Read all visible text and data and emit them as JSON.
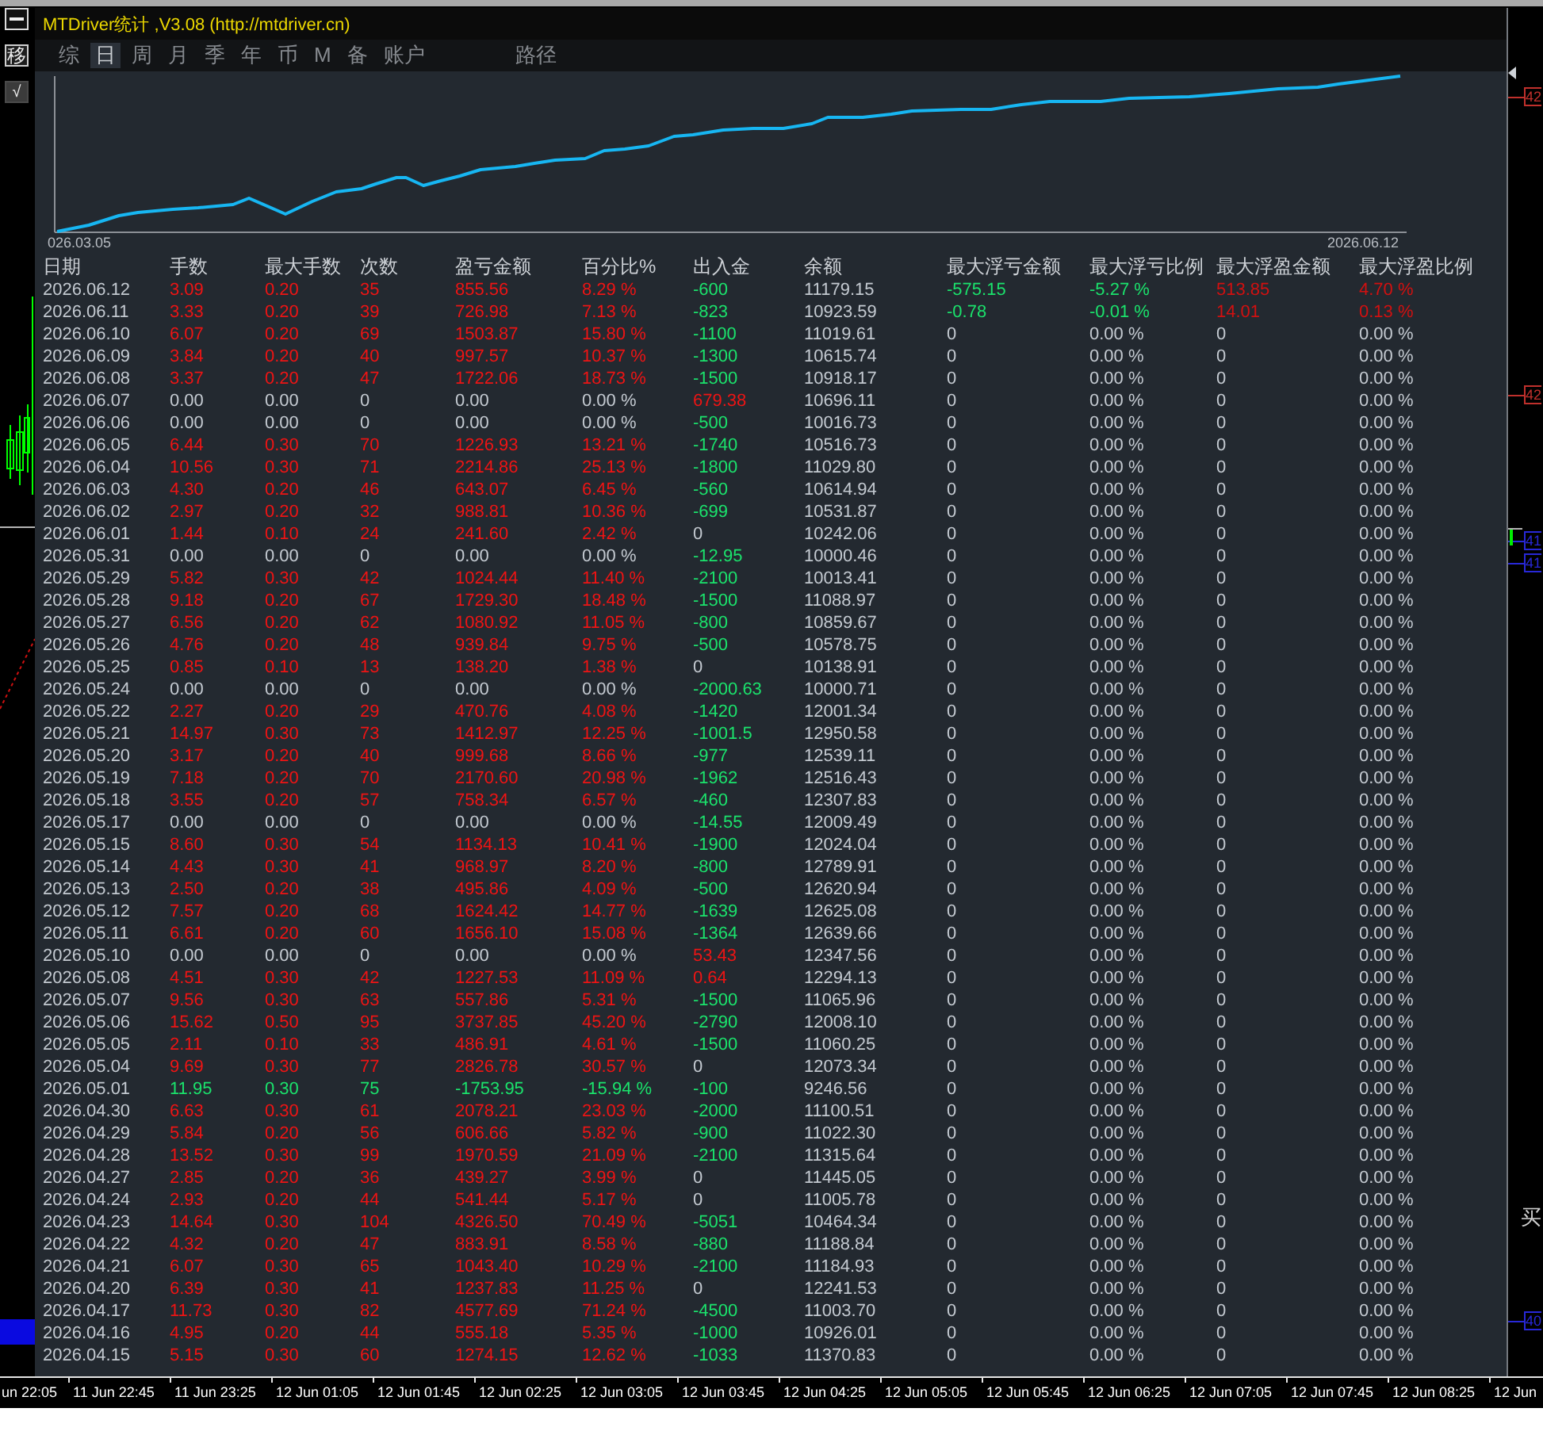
{
  "window": {
    "title": "MTDriver统计 ,V3.08 (http://mtdriver.cn)"
  },
  "side_buttons": [
    {
      "kind": "minimize"
    },
    {
      "kind": "char",
      "label": "移"
    },
    {
      "kind": "char",
      "label": "√"
    }
  ],
  "tabs": [
    {
      "label": "综",
      "selected": false
    },
    {
      "label": "日",
      "selected": true
    },
    {
      "label": "周",
      "selected": false
    },
    {
      "label": "月",
      "selected": false
    },
    {
      "label": "季",
      "selected": false
    },
    {
      "label": "年",
      "selected": false
    },
    {
      "label": "币",
      "selected": false
    },
    {
      "label": "M",
      "selected": false
    },
    {
      "label": "备",
      "selected": false
    },
    {
      "label": "账户",
      "selected": false
    }
  ],
  "path_tab": {
    "label": "路径",
    "selected": false
  },
  "equity_chart": {
    "start_label": "026.03.05",
    "end_label": "2026.06.12"
  },
  "table": {
    "columns": [
      "日期",
      "手数",
      "最大手数",
      "次数",
      "盈亏金额",
      "百分比%",
      "出入金",
      "余额",
      "最大浮亏金额",
      "最大浮亏比例",
      "最大浮盈金额",
      "最大浮盈比例"
    ],
    "rows": [
      {
        "profit": true,
        "loss": false,
        "deposit": false,
        "withdrawal": true,
        "floating": true,
        "cells": [
          "2026.06.12",
          "3.09",
          "0.20",
          "35",
          "855.56",
          "8.29 %",
          "-600",
          "11179.15",
          "-575.15",
          "-5.27 %",
          "513.85",
          "4.70 %"
        ]
      },
      {
        "profit": true,
        "loss": false,
        "deposit": false,
        "withdrawal": true,
        "floating": true,
        "cells": [
          "2026.06.11",
          "3.33",
          "0.20",
          "39",
          "726.98",
          "7.13 %",
          "-823",
          "10923.59",
          "-0.78",
          "-0.01 %",
          "14.01",
          "0.13 %"
        ]
      },
      {
        "profit": true,
        "loss": false,
        "deposit": false,
        "withdrawal": true,
        "floating": false,
        "cells": [
          "2026.06.10",
          "6.07",
          "0.20",
          "69",
          "1503.87",
          "15.80 %",
          "-1100",
          "11019.61",
          "0",
          "0.00 %",
          "0",
          "0.00 %"
        ]
      },
      {
        "profit": true,
        "loss": false,
        "deposit": false,
        "withdrawal": true,
        "floating": false,
        "cells": [
          "2026.06.09",
          "3.84",
          "0.20",
          "40",
          "997.57",
          "10.37 %",
          "-1300",
          "10615.74",
          "0",
          "0.00 %",
          "0",
          "0.00 %"
        ]
      },
      {
        "profit": true,
        "loss": false,
        "deposit": false,
        "withdrawal": true,
        "floating": false,
        "cells": [
          "2026.06.08",
          "3.37",
          "0.20",
          "47",
          "1722.06",
          "18.73 %",
          "-1500",
          "10918.17",
          "0",
          "0.00 %",
          "0",
          "0.00 %"
        ]
      },
      {
        "profit": false,
        "loss": false,
        "deposit": true,
        "withdrawal": false,
        "floating": false,
        "cells": [
          "2026.06.07",
          "0.00",
          "0.00",
          "0",
          "0.00",
          "0.00 %",
          "679.38",
          "10696.11",
          "0",
          "0.00 %",
          "0",
          "0.00 %"
        ]
      },
      {
        "profit": false,
        "loss": false,
        "deposit": false,
        "withdrawal": true,
        "floating": false,
        "cells": [
          "2026.06.06",
          "0.00",
          "0.00",
          "0",
          "0.00",
          "0.00 %",
          "-500",
          "10016.73",
          "0",
          "0.00 %",
          "0",
          "0.00 %"
        ]
      },
      {
        "profit": true,
        "loss": false,
        "deposit": false,
        "withdrawal": true,
        "floating": false,
        "cells": [
          "2026.06.05",
          "6.44",
          "0.30",
          "70",
          "1226.93",
          "13.21 %",
          "-1740",
          "10516.73",
          "0",
          "0.00 %",
          "0",
          "0.00 %"
        ]
      },
      {
        "profit": true,
        "loss": false,
        "deposit": false,
        "withdrawal": true,
        "floating": false,
        "cells": [
          "2026.06.04",
          "10.56",
          "0.30",
          "71",
          "2214.86",
          "25.13 %",
          "-1800",
          "11029.80",
          "0",
          "0.00 %",
          "0",
          "0.00 %"
        ]
      },
      {
        "profit": true,
        "loss": false,
        "deposit": false,
        "withdrawal": true,
        "floating": false,
        "cells": [
          "2026.06.03",
          "4.30",
          "0.20",
          "46",
          "643.07",
          "6.45 %",
          "-560",
          "10614.94",
          "0",
          "0.00 %",
          "0",
          "0.00 %"
        ]
      },
      {
        "profit": true,
        "loss": false,
        "deposit": false,
        "withdrawal": true,
        "floating": false,
        "cells": [
          "2026.06.02",
          "2.97",
          "0.20",
          "32",
          "988.81",
          "10.36 %",
          "-699",
          "10531.87",
          "0",
          "0.00 %",
          "0",
          "0.00 %"
        ]
      },
      {
        "profit": true,
        "loss": false,
        "deposit": false,
        "withdrawal": false,
        "floating": false,
        "cells": [
          "2026.06.01",
          "1.44",
          "0.10",
          "24",
          "241.60",
          "2.42 %",
          "0",
          "10242.06",
          "0",
          "0.00 %",
          "0",
          "0.00 %"
        ]
      },
      {
        "profit": false,
        "loss": false,
        "deposit": false,
        "withdrawal": true,
        "floating": false,
        "cells": [
          "2026.05.31",
          "0.00",
          "0.00",
          "0",
          "0.00",
          "0.00 %",
          "-12.95",
          "10000.46",
          "0",
          "0.00 %",
          "0",
          "0.00 %"
        ]
      },
      {
        "profit": true,
        "loss": false,
        "deposit": false,
        "withdrawal": true,
        "floating": false,
        "cells": [
          "2026.05.29",
          "5.82",
          "0.30",
          "42",
          "1024.44",
          "11.40 %",
          "-2100",
          "10013.41",
          "0",
          "0.00 %",
          "0",
          "0.00 %"
        ]
      },
      {
        "profit": true,
        "loss": false,
        "deposit": false,
        "withdrawal": true,
        "floating": false,
        "cells": [
          "2026.05.28",
          "9.18",
          "0.20",
          "67",
          "1729.30",
          "18.48 %",
          "-1500",
          "11088.97",
          "0",
          "0.00 %",
          "0",
          "0.00 %"
        ]
      },
      {
        "profit": true,
        "loss": false,
        "deposit": false,
        "withdrawal": true,
        "floating": false,
        "cells": [
          "2026.05.27",
          "6.56",
          "0.20",
          "62",
          "1080.92",
          "11.05 %",
          "-800",
          "10859.67",
          "0",
          "0.00 %",
          "0",
          "0.00 %"
        ]
      },
      {
        "profit": true,
        "loss": false,
        "deposit": false,
        "withdrawal": true,
        "floating": false,
        "cells": [
          "2026.05.26",
          "4.76",
          "0.20",
          "48",
          "939.84",
          "9.75 %",
          "-500",
          "10578.75",
          "0",
          "0.00 %",
          "0",
          "0.00 %"
        ]
      },
      {
        "profit": true,
        "loss": false,
        "deposit": false,
        "withdrawal": false,
        "floating": false,
        "cells": [
          "2026.05.25",
          "0.85",
          "0.10",
          "13",
          "138.20",
          "1.38 %",
          "0",
          "10138.91",
          "0",
          "0.00 %",
          "0",
          "0.00 %"
        ]
      },
      {
        "profit": false,
        "loss": false,
        "deposit": false,
        "withdrawal": true,
        "floating": false,
        "cells": [
          "2026.05.24",
          "0.00",
          "0.00",
          "0",
          "0.00",
          "0.00 %",
          "-2000.63",
          "10000.71",
          "0",
          "0.00 %",
          "0",
          "0.00 %"
        ]
      },
      {
        "profit": true,
        "loss": false,
        "deposit": false,
        "withdrawal": true,
        "floating": false,
        "cells": [
          "2026.05.22",
          "2.27",
          "0.20",
          "29",
          "470.76",
          "4.08 %",
          "-1420",
          "12001.34",
          "0",
          "0.00 %",
          "0",
          "0.00 %"
        ]
      },
      {
        "profit": true,
        "loss": false,
        "deposit": false,
        "withdrawal": true,
        "floating": false,
        "cells": [
          "2026.05.21",
          "14.97",
          "0.30",
          "73",
          "1412.97",
          "12.25 %",
          "-1001.5",
          "12950.58",
          "0",
          "0.00 %",
          "0",
          "0.00 %"
        ]
      },
      {
        "profit": true,
        "loss": false,
        "deposit": false,
        "withdrawal": true,
        "floating": false,
        "cells": [
          "2026.05.20",
          "3.17",
          "0.20",
          "40",
          "999.68",
          "8.66 %",
          "-977",
          "12539.11",
          "0",
          "0.00 %",
          "0",
          "0.00 %"
        ]
      },
      {
        "profit": true,
        "loss": false,
        "deposit": false,
        "withdrawal": true,
        "floating": false,
        "cells": [
          "2026.05.19",
          "7.18",
          "0.20",
          "70",
          "2170.60",
          "20.98 %",
          "-1962",
          "12516.43",
          "0",
          "0.00 %",
          "0",
          "0.00 %"
        ]
      },
      {
        "profit": true,
        "loss": false,
        "deposit": false,
        "withdrawal": true,
        "floating": false,
        "cells": [
          "2026.05.18",
          "3.55",
          "0.20",
          "57",
          "758.34",
          "6.57 %",
          "-460",
          "12307.83",
          "0",
          "0.00 %",
          "0",
          "0.00 %"
        ]
      },
      {
        "profit": false,
        "loss": false,
        "deposit": false,
        "withdrawal": true,
        "floating": false,
        "cells": [
          "2026.05.17",
          "0.00",
          "0.00",
          "0",
          "0.00",
          "0.00 %",
          "-14.55",
          "12009.49",
          "0",
          "0.00 %",
          "0",
          "0.00 %"
        ]
      },
      {
        "profit": true,
        "loss": false,
        "deposit": false,
        "withdrawal": true,
        "floating": false,
        "cells": [
          "2026.05.15",
          "8.60",
          "0.30",
          "54",
          "1134.13",
          "10.41 %",
          "-1900",
          "12024.04",
          "0",
          "0.00 %",
          "0",
          "0.00 %"
        ]
      },
      {
        "profit": true,
        "loss": false,
        "deposit": false,
        "withdrawal": true,
        "floating": false,
        "cells": [
          "2026.05.14",
          "4.43",
          "0.30",
          "41",
          "968.97",
          "8.20 %",
          "-800",
          "12789.91",
          "0",
          "0.00 %",
          "0",
          "0.00 %"
        ]
      },
      {
        "profit": true,
        "loss": false,
        "deposit": false,
        "withdrawal": true,
        "floating": false,
        "cells": [
          "2026.05.13",
          "2.50",
          "0.20",
          "38",
          "495.86",
          "4.09 %",
          "-500",
          "12620.94",
          "0",
          "0.00 %",
          "0",
          "0.00 %"
        ]
      },
      {
        "profit": true,
        "loss": false,
        "deposit": false,
        "withdrawal": true,
        "floating": false,
        "cells": [
          "2026.05.12",
          "7.57",
          "0.20",
          "68",
          "1624.42",
          "14.77 %",
          "-1639",
          "12625.08",
          "0",
          "0.00 %",
          "0",
          "0.00 %"
        ]
      },
      {
        "profit": true,
        "loss": false,
        "deposit": false,
        "withdrawal": true,
        "floating": false,
        "cells": [
          "2026.05.11",
          "6.61",
          "0.20",
          "60",
          "1656.10",
          "15.08 %",
          "-1364",
          "12639.66",
          "0",
          "0.00 %",
          "0",
          "0.00 %"
        ]
      },
      {
        "profit": false,
        "loss": false,
        "deposit": true,
        "withdrawal": false,
        "floating": false,
        "cells": [
          "2026.05.10",
          "0.00",
          "0.00",
          "0",
          "0.00",
          "0.00 %",
          "53.43",
          "12347.56",
          "0",
          "0.00 %",
          "0",
          "0.00 %"
        ]
      },
      {
        "profit": true,
        "loss": false,
        "deposit": true,
        "withdrawal": false,
        "floating": false,
        "cells": [
          "2026.05.08",
          "4.51",
          "0.30",
          "42",
          "1227.53",
          "11.09 %",
          "0.64",
          "12294.13",
          "0",
          "0.00 %",
          "0",
          "0.00 %"
        ]
      },
      {
        "profit": true,
        "loss": false,
        "deposit": false,
        "withdrawal": true,
        "floating": false,
        "cells": [
          "2026.05.07",
          "9.56",
          "0.30",
          "63",
          "557.86",
          "5.31 %",
          "-1500",
          "11065.96",
          "0",
          "0.00 %",
          "0",
          "0.00 %"
        ]
      },
      {
        "profit": true,
        "loss": false,
        "deposit": false,
        "withdrawal": true,
        "floating": false,
        "cells": [
          "2026.05.06",
          "15.62",
          "0.50",
          "95",
          "3737.85",
          "45.20 %",
          "-2790",
          "12008.10",
          "0",
          "0.00 %",
          "0",
          "0.00 %"
        ]
      },
      {
        "profit": true,
        "loss": false,
        "deposit": false,
        "withdrawal": true,
        "floating": false,
        "cells": [
          "2026.05.05",
          "2.11",
          "0.10",
          "33",
          "486.91",
          "4.61 %",
          "-1500",
          "11060.25",
          "0",
          "0.00 %",
          "0",
          "0.00 %"
        ]
      },
      {
        "profit": true,
        "loss": false,
        "deposit": false,
        "withdrawal": false,
        "floating": false,
        "cells": [
          "2026.05.04",
          "9.69",
          "0.30",
          "77",
          "2826.78",
          "30.57 %",
          "0",
          "12073.34",
          "0",
          "0.00 %",
          "0",
          "0.00 %"
        ]
      },
      {
        "profit": false,
        "loss": true,
        "deposit": false,
        "withdrawal": true,
        "floating": false,
        "cells": [
          "2026.05.01",
          "11.95",
          "0.30",
          "75",
          "-1753.95",
          "-15.94 %",
          "-100",
          "9246.56",
          "0",
          "0.00 %",
          "0",
          "0.00 %"
        ]
      },
      {
        "profit": true,
        "loss": false,
        "deposit": false,
        "withdrawal": true,
        "floating": false,
        "cells": [
          "2026.04.30",
          "6.63",
          "0.30",
          "61",
          "2078.21",
          "23.03 %",
          "-2000",
          "11100.51",
          "0",
          "0.00 %",
          "0",
          "0.00 %"
        ]
      },
      {
        "profit": true,
        "loss": false,
        "deposit": false,
        "withdrawal": true,
        "floating": false,
        "cells": [
          "2026.04.29",
          "5.84",
          "0.20",
          "56",
          "606.66",
          "5.82 %",
          "-900",
          "11022.30",
          "0",
          "0.00 %",
          "0",
          "0.00 %"
        ]
      },
      {
        "profit": true,
        "loss": false,
        "deposit": false,
        "withdrawal": true,
        "floating": false,
        "cells": [
          "2026.04.28",
          "13.52",
          "0.30",
          "99",
          "1970.59",
          "21.09 %",
          "-2100",
          "11315.64",
          "0",
          "0.00 %",
          "0",
          "0.00 %"
        ]
      },
      {
        "profit": true,
        "loss": false,
        "deposit": false,
        "withdrawal": false,
        "floating": false,
        "cells": [
          "2026.04.27",
          "2.85",
          "0.20",
          "36",
          "439.27",
          "3.99 %",
          "0",
          "11445.05",
          "0",
          "0.00 %",
          "0",
          "0.00 %"
        ]
      },
      {
        "profit": true,
        "loss": false,
        "deposit": false,
        "withdrawal": false,
        "floating": false,
        "cells": [
          "2026.04.24",
          "2.93",
          "0.20",
          "44",
          "541.44",
          "5.17 %",
          "0",
          "11005.78",
          "0",
          "0.00 %",
          "0",
          "0.00 %"
        ]
      },
      {
        "profit": true,
        "loss": false,
        "deposit": false,
        "withdrawal": true,
        "floating": false,
        "cells": [
          "2026.04.23",
          "14.64",
          "0.30",
          "104",
          "4326.50",
          "70.49 %",
          "-5051",
          "10464.34",
          "0",
          "0.00 %",
          "0",
          "0.00 %"
        ]
      },
      {
        "profit": true,
        "loss": false,
        "deposit": false,
        "withdrawal": true,
        "floating": false,
        "cells": [
          "2026.04.22",
          "4.32",
          "0.20",
          "47",
          "883.91",
          "8.58 %",
          "-880",
          "11188.84",
          "0",
          "0.00 %",
          "0",
          "0.00 %"
        ]
      },
      {
        "profit": true,
        "loss": false,
        "deposit": false,
        "withdrawal": true,
        "floating": false,
        "cells": [
          "2026.04.21",
          "6.07",
          "0.30",
          "65",
          "1043.40",
          "10.29 %",
          "-2100",
          "11184.93",
          "0",
          "0.00 %",
          "0",
          "0.00 %"
        ]
      },
      {
        "profit": true,
        "loss": false,
        "deposit": false,
        "withdrawal": false,
        "floating": false,
        "cells": [
          "2026.04.20",
          "6.39",
          "0.30",
          "41",
          "1237.83",
          "11.25 %",
          "0",
          "12241.53",
          "0",
          "0.00 %",
          "0",
          "0.00 %"
        ]
      },
      {
        "profit": true,
        "loss": false,
        "deposit": false,
        "withdrawal": true,
        "floating": false,
        "cells": [
          "2026.04.17",
          "11.73",
          "0.30",
          "82",
          "4577.69",
          "71.24 %",
          "-4500",
          "11003.70",
          "0",
          "0.00 %",
          "0",
          "0.00 %"
        ]
      },
      {
        "profit": true,
        "loss": false,
        "deposit": false,
        "withdrawal": true,
        "floating": false,
        "cells": [
          "2026.04.16",
          "4.95",
          "0.20",
          "44",
          "555.18",
          "5.35 %",
          "-1000",
          "10926.01",
          "0",
          "0.00 %",
          "0",
          "0.00 %"
        ]
      },
      {
        "profit": true,
        "loss": false,
        "deposit": false,
        "withdrawal": true,
        "floating": false,
        "cells": [
          "2026.04.15",
          "5.15",
          "0.30",
          "60",
          "1274.15",
          "12.62 %",
          "-1033",
          "11370.83",
          "0",
          "0.00 %",
          "0",
          "0.00 %"
        ]
      }
    ]
  },
  "right_axis": {
    "tags": [
      {
        "label": "42",
        "color": "#c0302c"
      },
      {
        "label": "42",
        "color": "#c0302c"
      },
      {
        "label": "41",
        "color": "#2828d8"
      },
      {
        "label": "41",
        "color": "#2828d8"
      },
      {
        "label": "40",
        "color": "#2828d8"
      }
    ],
    "side_label": "买"
  },
  "time_axis": {
    "labels": [
      "un 22:05",
      "11 Jun 22:45",
      "11 Jun 23:25",
      "12 Jun 01:05",
      "12 Jun 01:45",
      "12 Jun 02:25",
      "12 Jun 03:05",
      "12 Jun 03:45",
      "12 Jun 04:25",
      "12 Jun 05:05",
      "12 Jun 05:45",
      "12 Jun 06:25",
      "12 Jun 07:05",
      "12 Jun 07:45",
      "12 Jun 08:25",
      "12 Jun"
    ]
  }
}
